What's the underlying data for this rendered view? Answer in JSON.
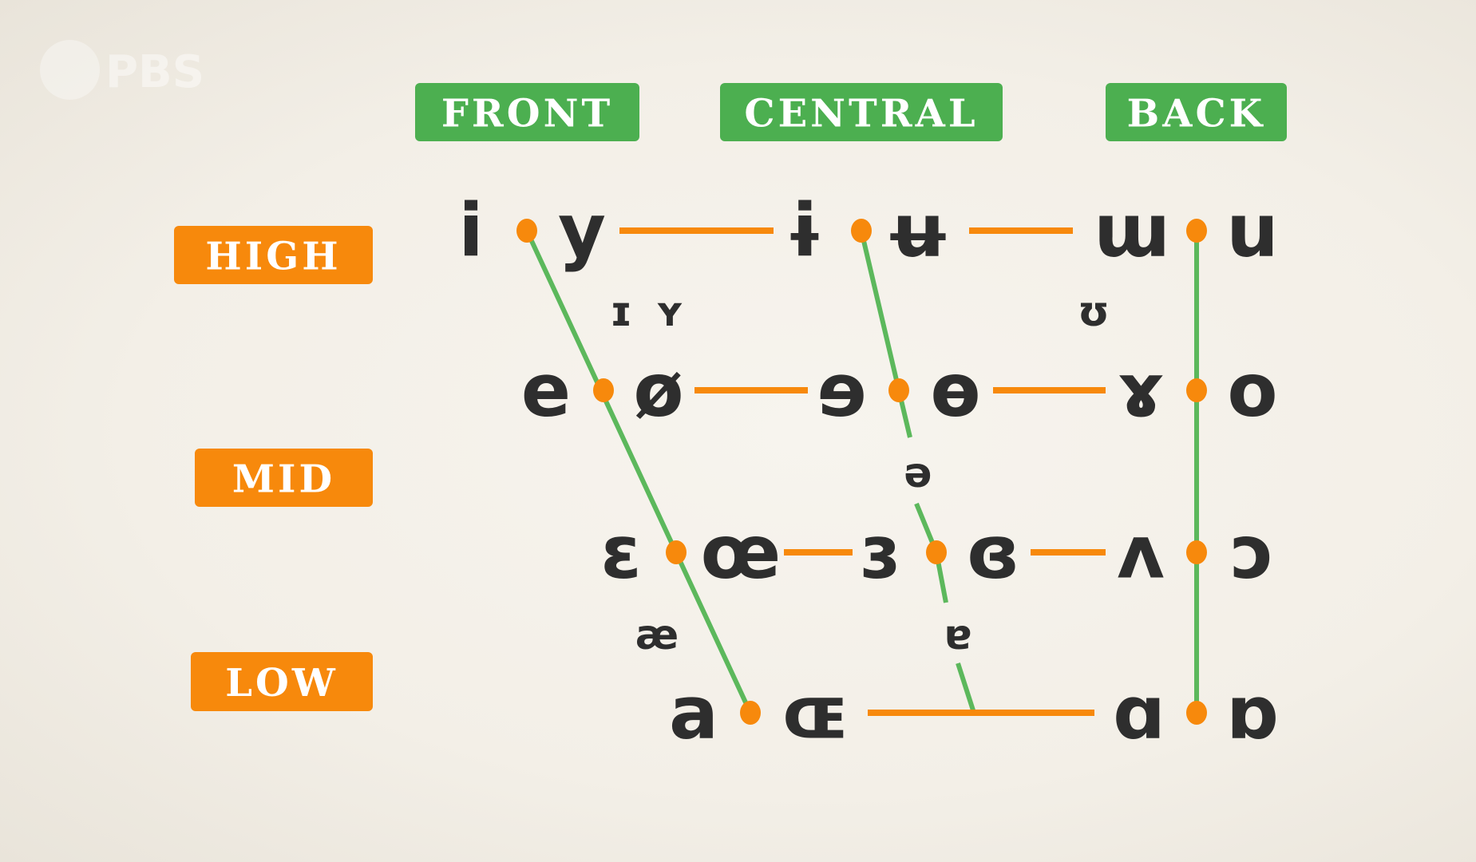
{
  "logo": {
    "text": "PBS"
  },
  "columns": [
    "FRONT",
    "CENTRAL",
    "BACK"
  ],
  "rows": [
    "HIGH",
    "MID",
    "LOW"
  ],
  "colors": {
    "column_label_bg": "#4caf50",
    "row_label_bg": "#f7890c",
    "front_central_back_lines": "#5cb85c",
    "row_lines": "#f7890c",
    "dots": "#f7890c",
    "symbols": "#2e2e2e"
  },
  "vowels": {
    "close": [
      "i",
      "y",
      "ɨ",
      "ʉ",
      "ɯ",
      "u"
    ],
    "near_close": [
      "ɪ",
      "ʏ",
      "ʊ"
    ],
    "close_mid": [
      "e",
      "ø",
      "ɘ",
      "ɵ",
      "ɤ",
      "o"
    ],
    "mid": [
      "ə"
    ],
    "open_mid": [
      "ɛ",
      "œ",
      "ɜ",
      "ɞ",
      "ʌ",
      "ɔ"
    ],
    "near_open": [
      "æ",
      "ɐ"
    ],
    "open": [
      "a",
      "ɶ",
      "ɑ",
      "ɒ"
    ]
  }
}
